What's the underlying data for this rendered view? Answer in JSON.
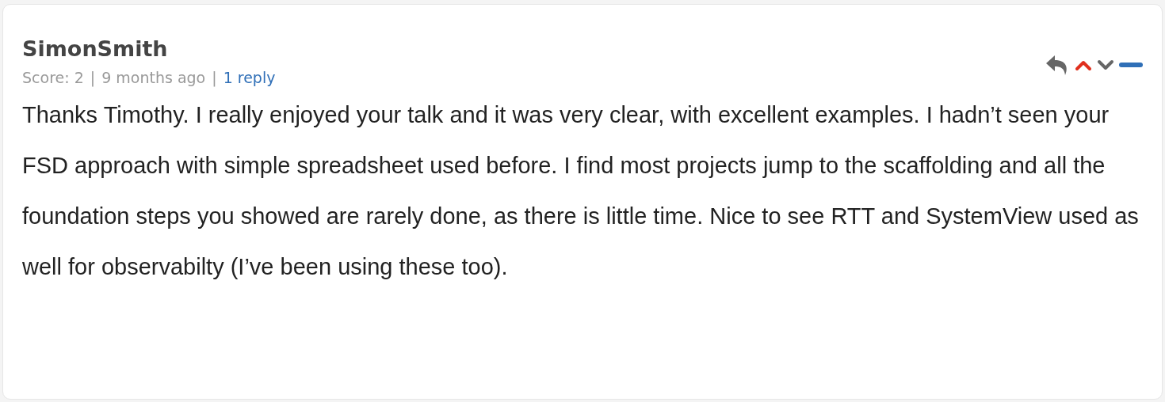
{
  "comment": {
    "author": "SimonSmith",
    "score": "Score: 2",
    "time": "9 months ago",
    "separator": "|",
    "replies": "1 reply",
    "upvoted": true,
    "downvoted": false,
    "collapsed": false,
    "body": "Thanks Timothy. I really enjoyed your talk and it was very clear, with excellent examples. I hadn’t seen your FSD approach with simple spreadsheet used before. I find most projects jump to the scaffolding and all the foundation steps you showed are rarely done, as there is little time. Nice to see RTT and SystemView used as well for observabilty (I’ve been using these too)."
  }
}
